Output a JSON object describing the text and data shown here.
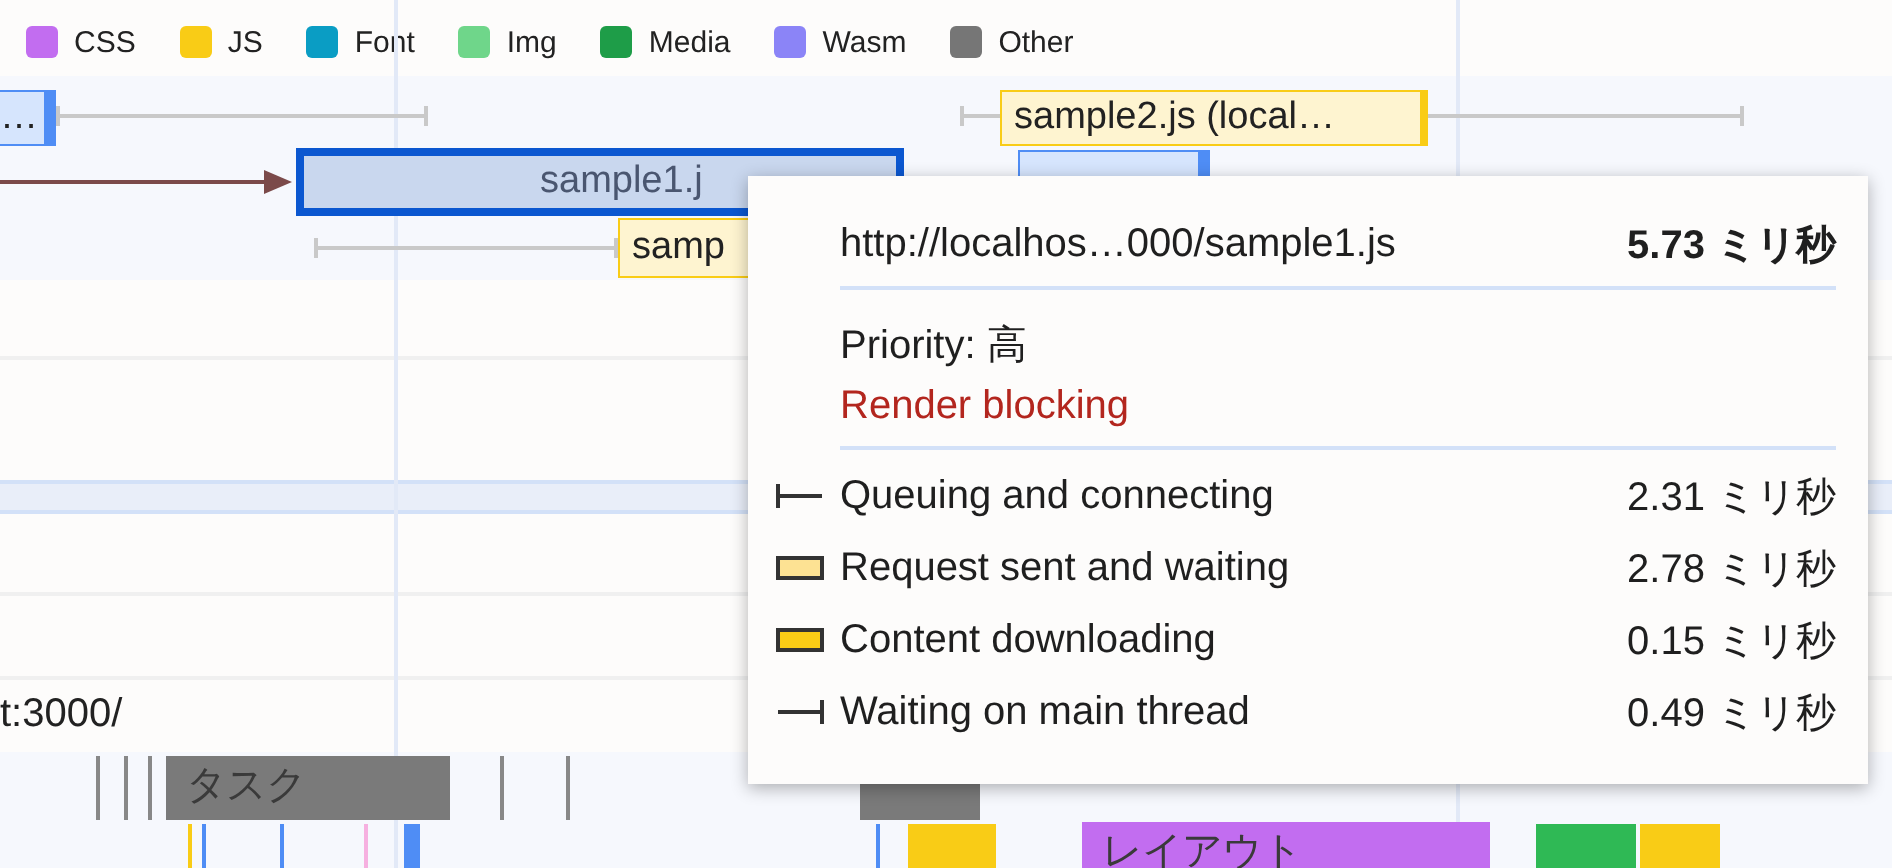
{
  "legend": [
    {
      "label": "CSS",
      "color": "#c26df0"
    },
    {
      "label": "JS",
      "color": "#f9cc16"
    },
    {
      "label": "Font",
      "color": "#0a9dc4"
    },
    {
      "label": "Img",
      "color": "#6fd68a"
    },
    {
      "label": "Media",
      "color": "#1e9d48"
    },
    {
      "label": "Wasm",
      "color": "#8b84f7"
    },
    {
      "label": "Other",
      "color": "#767676"
    }
  ],
  "network_bars": [
    {
      "label": "…",
      "kind": "doc",
      "selected": false
    },
    {
      "label": "sample2.js (local…",
      "kind": "js",
      "selected": false
    },
    {
      "label": "sample1.j",
      "kind": "js",
      "selected": true
    },
    {
      "label": "samp",
      "kind": "js",
      "selected": false
    },
    {
      "kind": "doc",
      "selected": false
    }
  ],
  "track_label": "t:3000/",
  "tasks": [
    {
      "label": "タスク",
      "kind": "task"
    },
    {
      "label": "レイアウト",
      "kind": "layout"
    }
  ],
  "tooltip": {
    "url": "http://localhos…000/sample1.js",
    "duration": "5.73 ミリ秒",
    "priority": "Priority: 高",
    "render_blocking": "Render blocking",
    "phases": [
      {
        "kind": "queue",
        "label": "Queuing and connecting",
        "time": "2.31 ミリ秒"
      },
      {
        "kind": "request",
        "label": "Request sent and waiting",
        "time": "2.78 ミリ秒"
      },
      {
        "kind": "download",
        "label": "Content downloading",
        "time": "0.15 ミリ秒"
      },
      {
        "kind": "wait",
        "label": "Waiting on main thread",
        "time": "0.49 ミリ秒"
      }
    ]
  }
}
